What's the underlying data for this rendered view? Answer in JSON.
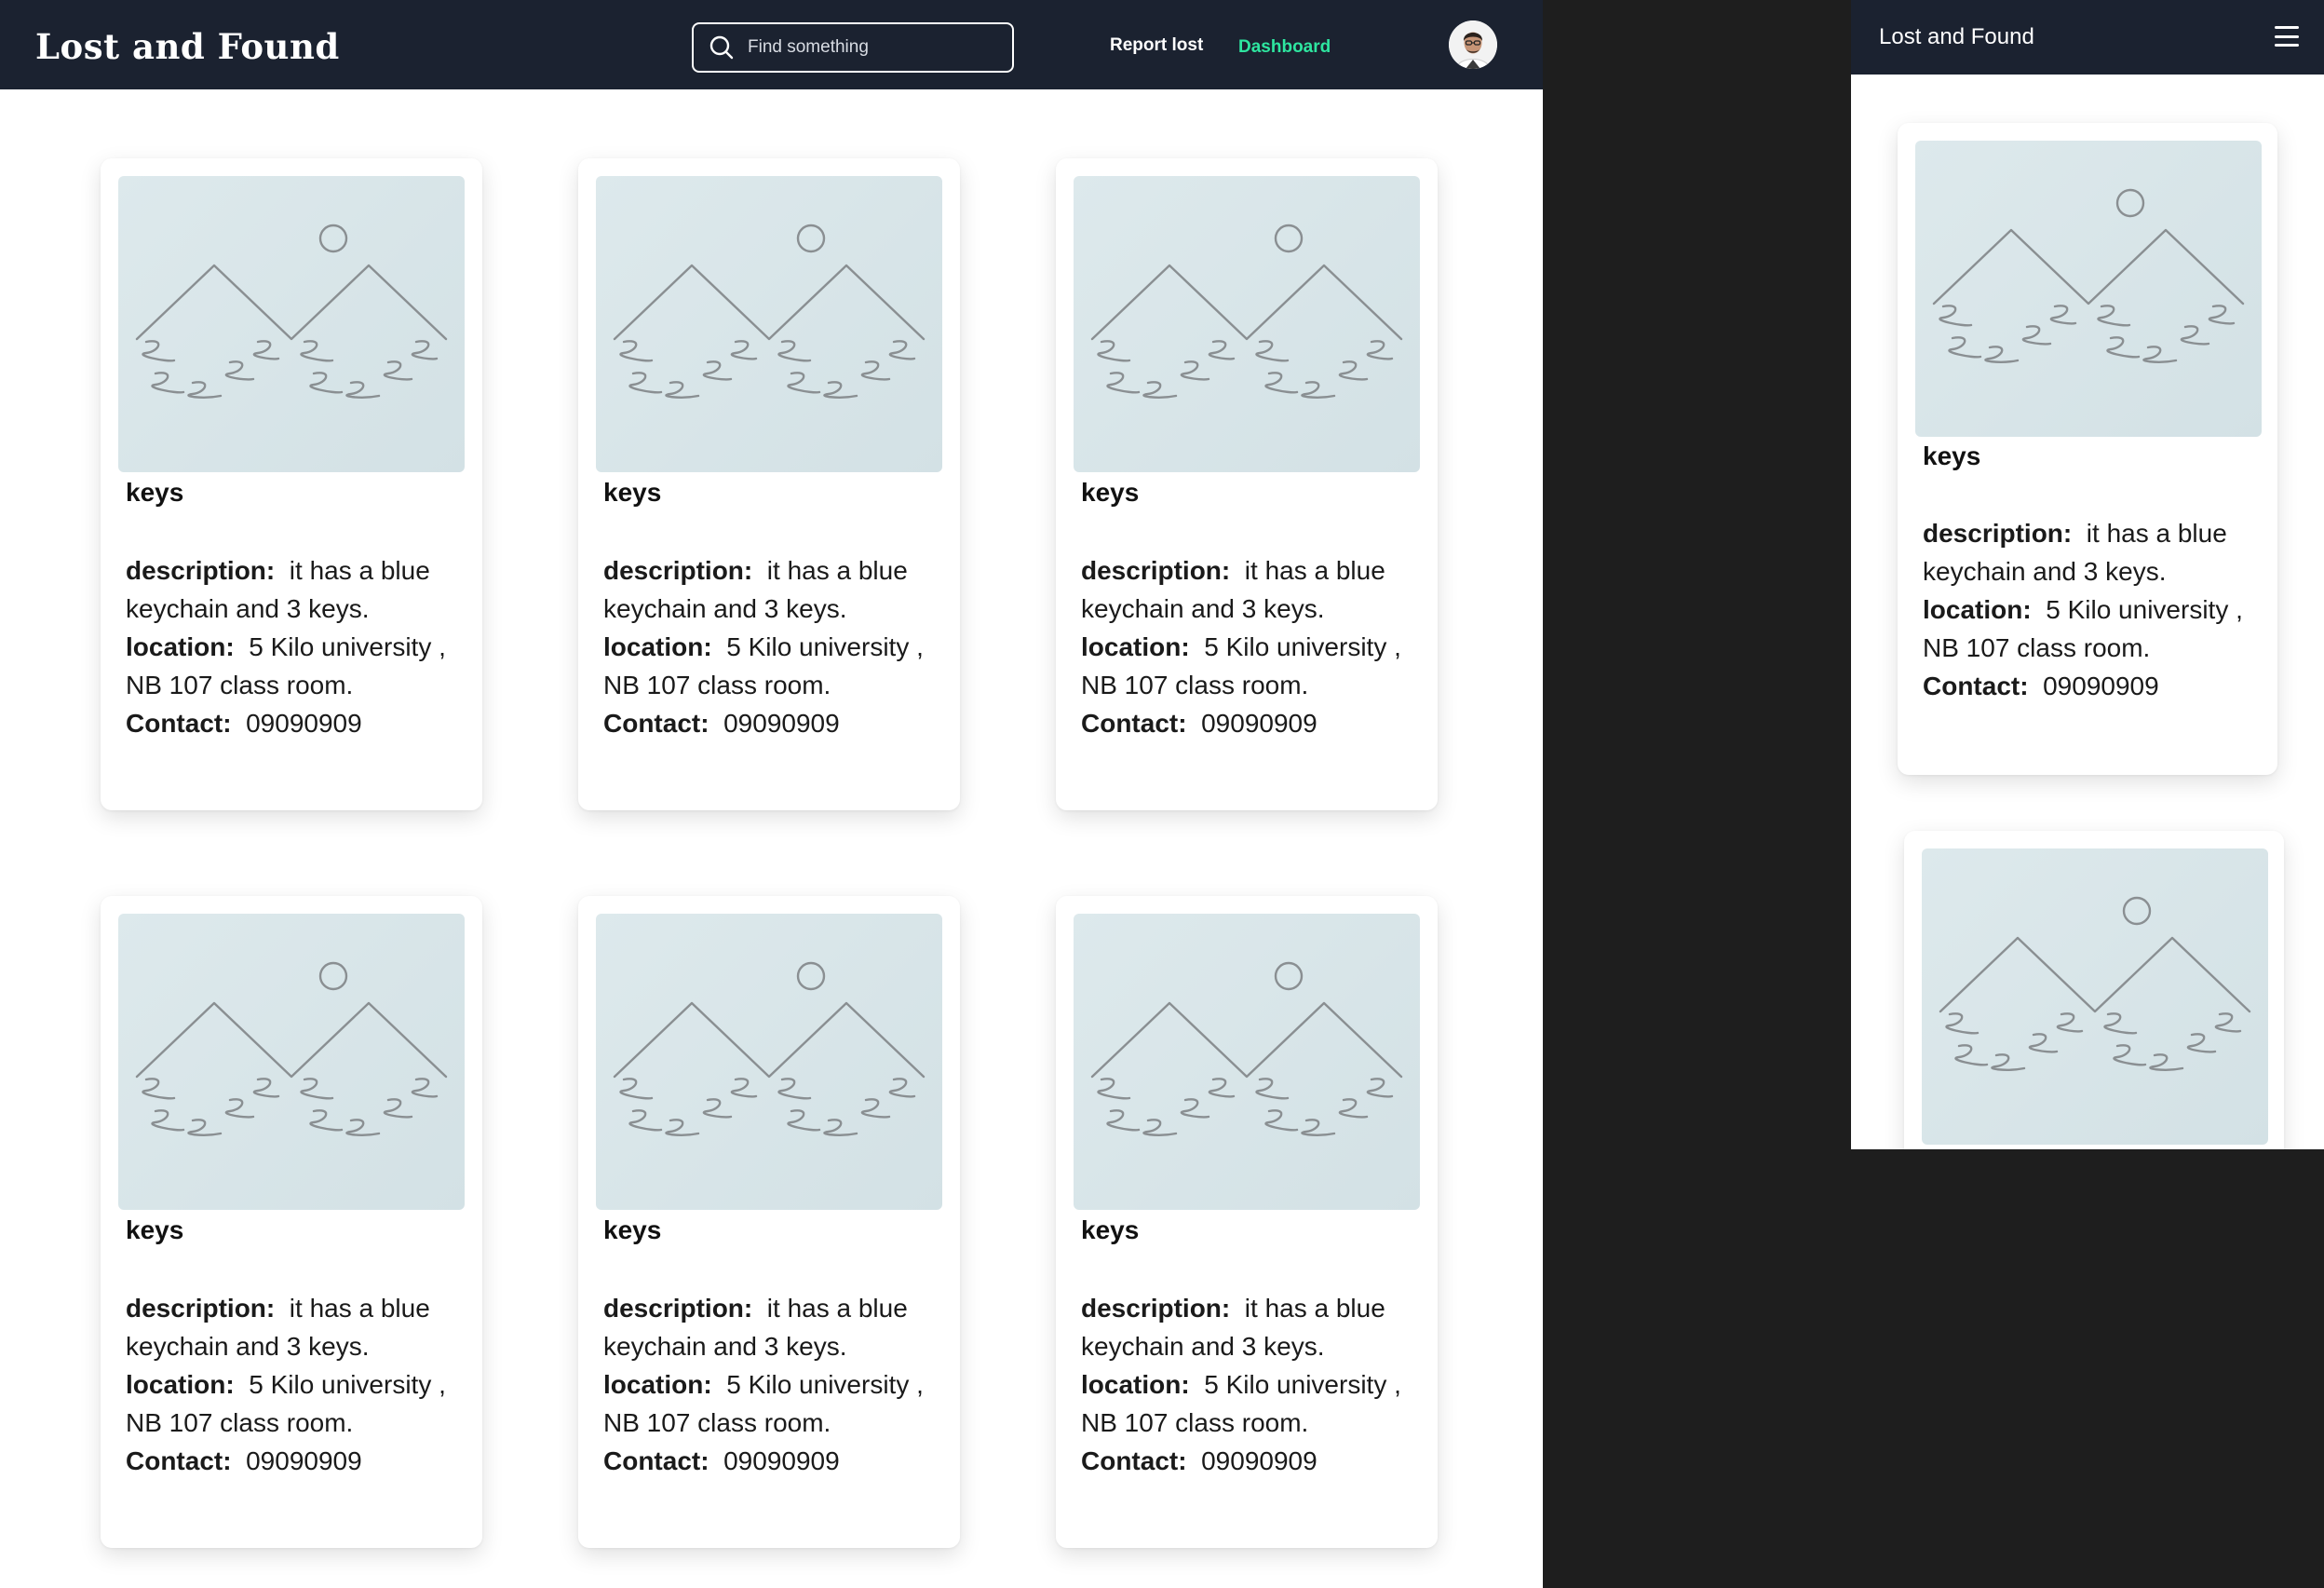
{
  "desktop": {
    "header": {
      "logo": "Lost and Found",
      "search_placeholder": "Find something",
      "nav_report": "Report lost",
      "nav_dashboard": "Dashboard"
    },
    "cards": [
      {
        "title": "keys",
        "description_label": "description:",
        "description": "it has a blue keychain and 3 keys.",
        "location_label": "location:",
        "location": "5 Kilo university , NB 107 class room.",
        "contact_label": "Contact:",
        "contact": "09090909"
      },
      {
        "title": "keys",
        "description_label": "description:",
        "description": "it has a blue keychain and 3 keys.",
        "location_label": "location:",
        "location": "5 Kilo university , NB 107 class room.",
        "contact_label": "Contact:",
        "contact": "09090909"
      },
      {
        "title": "keys",
        "description_label": "description:",
        "description": "it has a blue keychain and 3 keys.",
        "location_label": "location:",
        "location": "5 Kilo university , NB 107 class room.",
        "contact_label": "Contact:",
        "contact": "09090909"
      },
      {
        "title": "keys",
        "description_label": "description:",
        "description": "it has a blue keychain and 3 keys.",
        "location_label": "location:",
        "location": "5 Kilo university , NB 107 class room.",
        "contact_label": "Contact:",
        "contact": "09090909"
      },
      {
        "title": "keys",
        "description_label": "description:",
        "description": "it has a blue keychain and 3 keys.",
        "location_label": "location:",
        "location": "5 Kilo university , NB 107 class room.",
        "contact_label": "Contact:",
        "contact": "09090909"
      },
      {
        "title": "keys",
        "description_label": "description:",
        "description": "it has a blue keychain and 3 keys.",
        "location_label": "location:",
        "location": "5 Kilo university , NB 107 class room.",
        "contact_label": "Contact:",
        "contact": "09090909"
      }
    ]
  },
  "mobile": {
    "header": {
      "title": "Lost and Found"
    },
    "cards": [
      {
        "title": "keys",
        "description_label": "description:",
        "description": "it has a blue keychain and 3 keys.",
        "location_label": "location:",
        "location": "5 Kilo university , NB 107 class room.",
        "contact_label": "Contact:",
        "contact": "09090909"
      }
    ]
  },
  "colors": {
    "header_bg": "#1b2230",
    "accent": "#2ee6a0",
    "page_bg": "#1e1e1e",
    "placeholder_bg": "#d8e5e8",
    "placeholder_stroke": "#8a8f92"
  },
  "icons": [
    "search-icon",
    "avatar",
    "hamburger-menu-icon",
    "image-placeholder-icon"
  ]
}
